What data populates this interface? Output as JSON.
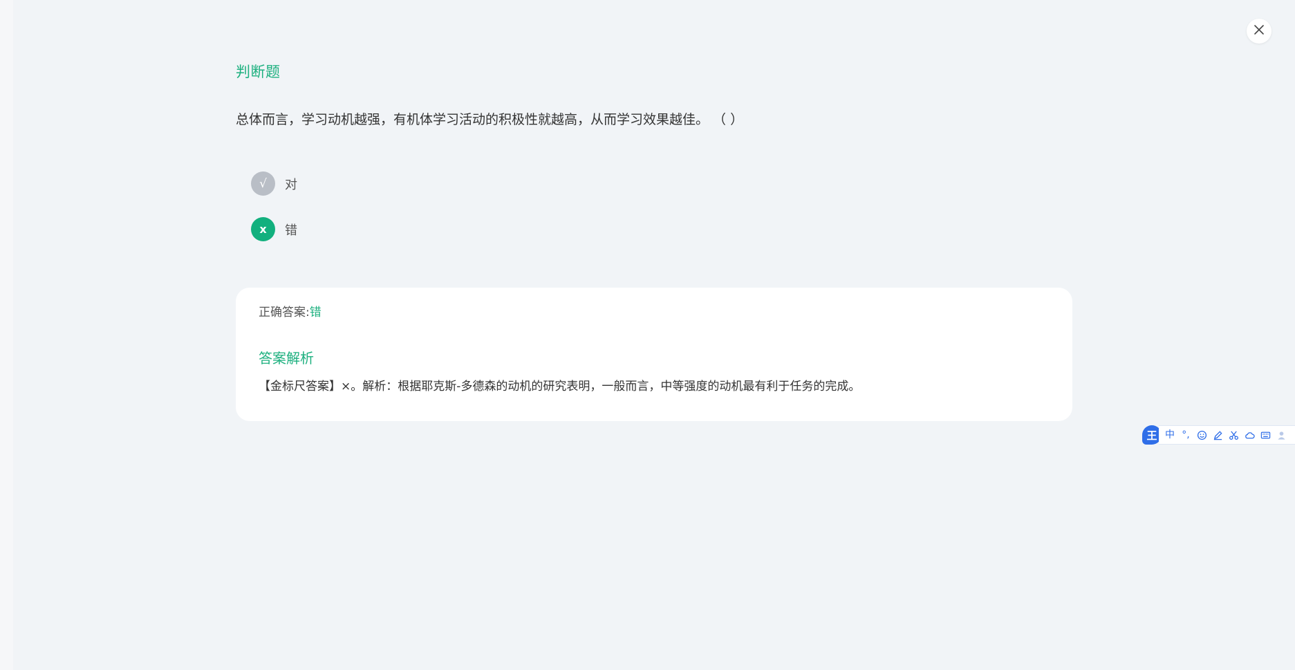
{
  "question": {
    "type_label": "判断题",
    "text": "总体而言，学习动机越强，有机体学习活动的积极性就越高，从而学习效果越佳。 （ ）"
  },
  "options": [
    {
      "mark": "√",
      "label": "对"
    },
    {
      "mark": "x",
      "label": "错"
    }
  ],
  "answer": {
    "correct_prefix": "正确答案:",
    "correct_value": "错",
    "analysis_title": "答案解析",
    "analysis_text": "【金标尺答案】×。解析：根据耶克斯-多德森的动机的研究表明，一般而言，中等强度的动机最有利于任务的完成。"
  },
  "ime_toolbar": {
    "logo_char": "王",
    "mode_char": "中",
    "punct_char": "°,",
    "icons": [
      "smile-icon",
      "pen-icon",
      "scissors-icon",
      "cloud-icon",
      "keyboard-icon",
      "user-icon"
    ]
  },
  "colors": {
    "accent_green": "#1db07f",
    "selected_green": "#12b07e",
    "unselected_gray": "#b9bec6",
    "ime_blue": "#2f6ee8",
    "page_bg": "#f1f4f7"
  }
}
